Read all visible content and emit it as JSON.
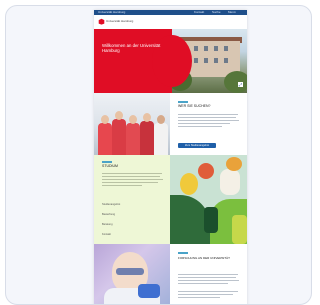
{
  "topbar": {
    "site": "Universität Hamburg",
    "links": [
      "Kontakt",
      "Suche",
      "Menü"
    ]
  },
  "logo": {
    "name": "Universität Hamburg"
  },
  "hero": {
    "title": "Willkommen an der Universität Hamburg"
  },
  "section1": {
    "heading": "WER SIE SUCHEN?",
    "button": "Zum Studienangebot"
  },
  "section2": {
    "heading": "STUDIUM",
    "links": [
      "Studienangebot",
      "Bewerbung",
      "Beratung",
      "Kontakt"
    ]
  },
  "section3": {
    "heading": "FORSCHUNG AN DER UNIVERSITÄT"
  },
  "colors": {
    "brand_red": "#e00d25",
    "brand_blue": "#1f4f8a",
    "accent_green_bg": "#eef7d6"
  },
  "icons": {
    "hero_corner": "expand-icon",
    "logo": "university-logo-icon"
  }
}
